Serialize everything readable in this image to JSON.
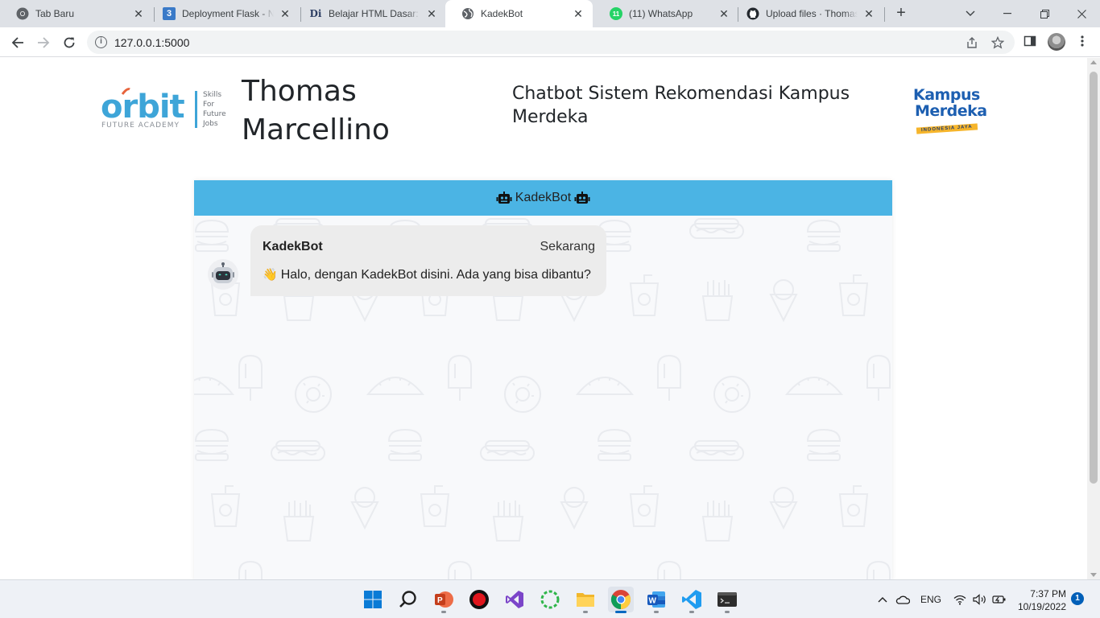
{
  "browser": {
    "tabs": [
      {
        "title": "Tab Baru",
        "icon": "chrome-icon"
      },
      {
        "title": "Deployment Flask - Na",
        "icon": "numbered-3-icon",
        "icon_text": "3"
      },
      {
        "title": "Belajar HTML Dasar: C",
        "icon": "dicoding-icon",
        "icon_text": "Di"
      },
      {
        "title": "KadekBot",
        "icon": "globe-icon",
        "active": true
      },
      {
        "title": "(11) WhatsApp",
        "icon": "whatsapp-icon",
        "icon_text": "11"
      },
      {
        "title": "Upload files · Thomas",
        "icon": "github-icon"
      }
    ],
    "url": "127.0.0.1:5000"
  },
  "page": {
    "orbit_logo": {
      "word": "orbit",
      "tagline": "FUTURE ACADEMY",
      "side_text": [
        "Skills",
        "For",
        "Future",
        "Jobs"
      ]
    },
    "name": "Thomas Marcellino",
    "subtitle": "Chatbot Sistem Rekomendasi Kampus Merdeka",
    "km_logo": {
      "line1": "Kampus",
      "line2": "Merdeka",
      "ribbon": "INDONESIA JAYA"
    }
  },
  "chat": {
    "header_title": "KadekBot",
    "messages": [
      {
        "sender": "KadekBot",
        "time": "Sekarang",
        "emoji": "👋",
        "text": "Halo, dengan KadekBot disini. Ada yang bisa dibantu?"
      }
    ]
  },
  "taskbar": {
    "apps": [
      "start-icon",
      "search-icon",
      "powerpoint-icon",
      "obs-icon",
      "visual-studio-icon",
      "spinner-app-icon",
      "file-explorer-icon",
      "chrome-icon",
      "word-icon",
      "vscode-icon",
      "terminal-icon"
    ],
    "language": "ENG",
    "time": "7:37 PM",
    "date": "10/19/2022",
    "notification_count": "1"
  },
  "colors": {
    "chat_header": "#4bb4e4",
    "chat_bg": "#f8f9fb",
    "bubble": "#ececec",
    "orbit_blue": "#3ea5d8",
    "km_blue": "#1d5fb1",
    "km_yellow": "#f6b52b"
  }
}
